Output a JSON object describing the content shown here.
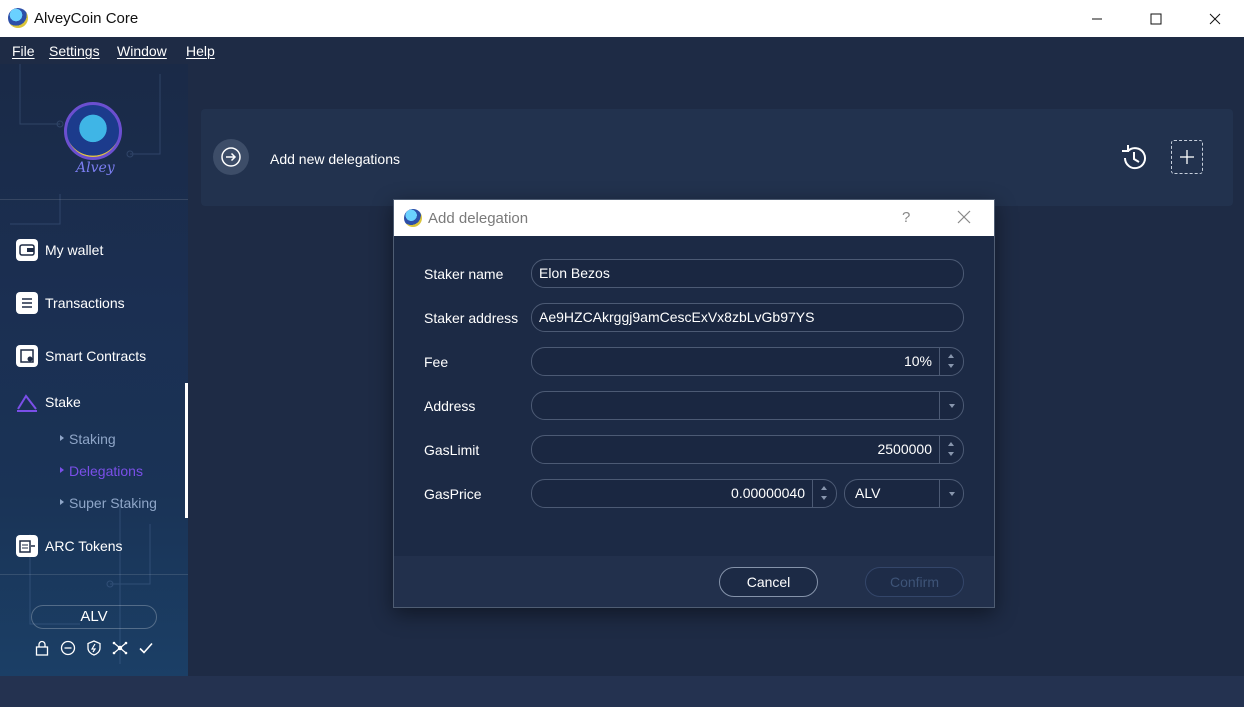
{
  "window": {
    "title": "AlveyCoin Core"
  },
  "menu": {
    "file": "File",
    "settings": "Settings",
    "window": "Window",
    "help": "Help"
  },
  "sidebar": {
    "logo_text": "Alvey",
    "items": [
      {
        "label": "My wallet",
        "icon": "wallet-icon"
      },
      {
        "label": "Transactions",
        "icon": "list-icon"
      },
      {
        "label": "Smart Contracts",
        "icon": "contract-icon"
      },
      {
        "label": "Stake",
        "icon": "stake-icon"
      },
      {
        "label": "ARC Tokens",
        "icon": "token-icon"
      }
    ],
    "stake_sub": [
      {
        "label": "Staking"
      },
      {
        "label": "Delegations"
      },
      {
        "label": "Super Staking"
      }
    ],
    "unit": "ALV",
    "status_icons": [
      "lock-icon",
      "minus-circle-icon",
      "shield-icon",
      "network-icon",
      "check-icon"
    ]
  },
  "header": {
    "title": "Add new delegations"
  },
  "dialog": {
    "title": "Add delegation",
    "help": "?",
    "fields": {
      "staker_name": {
        "label": "Staker name",
        "value": "Elon Bezos"
      },
      "staker_address": {
        "label": "Staker address",
        "value": "Ae9HZCAkrggj9amCescExVx8zbLvGb97YS"
      },
      "fee": {
        "label": "Fee",
        "value": "10%"
      },
      "address": {
        "label": "Address",
        "value": ""
      },
      "gas_limit": {
        "label": "GasLimit",
        "value": "2500000"
      },
      "gas_price": {
        "label": "GasPrice",
        "value": "0.00000040",
        "unit": "ALV"
      }
    },
    "buttons": {
      "cancel": "Cancel",
      "confirm": "Confirm"
    }
  },
  "colors": {
    "accent": "#7a4fe8",
    "background": "#1e2b45",
    "card": "#22324e"
  }
}
